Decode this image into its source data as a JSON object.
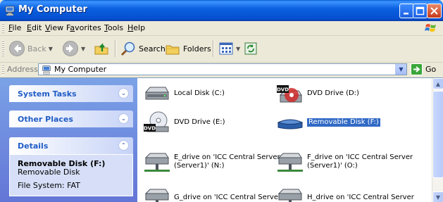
{
  "window": {
    "title": "My Computer",
    "icon": "my-computer-icon"
  },
  "menu": [
    {
      "label": "File",
      "underline": "F",
      "rest": "ile"
    },
    {
      "label": "Edit",
      "underline": "E",
      "rest": "dit"
    },
    {
      "label": "View",
      "underline": "V",
      "rest": "iew"
    },
    {
      "label": "Favorites",
      "underline": "a",
      "pre": "F",
      "rest": "vorites"
    },
    {
      "label": "Tools",
      "underline": "T",
      "rest": "ools"
    },
    {
      "label": "Help",
      "underline": "H",
      "rest": "elp"
    }
  ],
  "toolbar": {
    "back_label": "Back",
    "search_label": "Search",
    "folders_label": "Folders"
  },
  "address": {
    "label": "Address",
    "value": "My Computer",
    "go_label": "Go"
  },
  "taskpane": {
    "system_tasks": "System Tasks",
    "other_places": "Other Places",
    "details": "Details",
    "details_name": "Removable Disk (F:)",
    "details_type": "Removable Disk",
    "details_fs": "File System: FAT"
  },
  "files": [
    {
      "label": "Local Disk (C:)",
      "icon": "hard-drive-icon"
    },
    {
      "label": "DVD Drive (D:)",
      "icon": "dvd-drive-icon"
    },
    {
      "label": "DVD Drive (E:)",
      "icon": "dvd-drive-icon"
    },
    {
      "label": "Removable Disk (F:)",
      "icon": "removable-disk-icon",
      "selected": true
    },
    {
      "label": "E_drive on 'ICC Central Server\n(Server1)' (N:)",
      "icon": "network-drive-icon"
    },
    {
      "label": "F_drive on 'ICC Central Server\n(Server1)' (O:)",
      "icon": "network-drive-icon"
    },
    {
      "label": "G_drive on 'ICC Central Server",
      "icon": "network-drive-icon"
    },
    {
      "label": "H_drive on 'ICC Central Server",
      "icon": "network-drive-icon"
    }
  ],
  "colors": {
    "titlebar": "#0450d1",
    "selection": "#316ac5",
    "taskpane_header_text": "#215dc6"
  }
}
